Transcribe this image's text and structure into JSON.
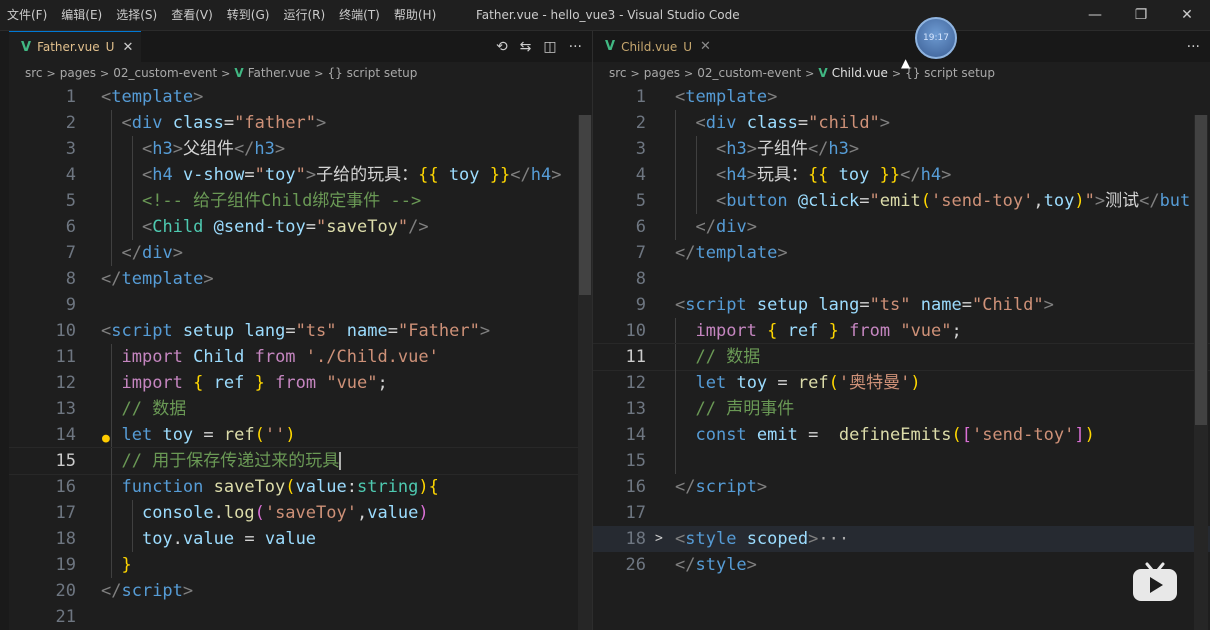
{
  "menu": [
    "文件(F)",
    "编辑(E)",
    "选择(S)",
    "查看(V)",
    "转到(G)",
    "运行(R)",
    "终端(T)",
    "帮助(H)"
  ],
  "window_title": "Father.vue - hello_vue3 - Visual Studio Code",
  "window_controls": {
    "minimize": "—",
    "restore": "❐",
    "close": "✕"
  },
  "clock_badge": "19:17",
  "left": {
    "tab": {
      "name": "Father.vue",
      "status": "U",
      "close": "✕"
    },
    "actions": {
      "timeline": "⟲",
      "compare": "⇆",
      "split": "◫",
      "more": "···"
    },
    "breadcrumb": [
      "src",
      "pages",
      "02_custom-event",
      "Father.vue",
      "{} script setup"
    ]
  },
  "right": {
    "tab": {
      "name": "Child.vue",
      "status": "U",
      "close": "✕"
    },
    "actions": {
      "more": "···"
    },
    "breadcrumb": [
      "src",
      "pages",
      "02_custom-event",
      "Child.vue",
      "{} script setup"
    ]
  },
  "father_lines": [
    "1",
    "2",
    "3",
    "4",
    "5",
    "6",
    "7",
    "8",
    "9",
    "10",
    "11",
    "12",
    "13",
    "14",
    "15",
    "16",
    "17",
    "18",
    "19",
    "20",
    "21"
  ],
  "child_lines": [
    "1",
    "2",
    "3",
    "4",
    "5",
    "6",
    "7",
    "8",
    "9",
    "10",
    "11",
    "12",
    "13",
    "14",
    "15",
    "16",
    "17",
    "18",
    "26"
  ],
  "colors": {
    "accent": "#0078d4",
    "vue": "#41b883",
    "modified": "#e2c08d"
  }
}
